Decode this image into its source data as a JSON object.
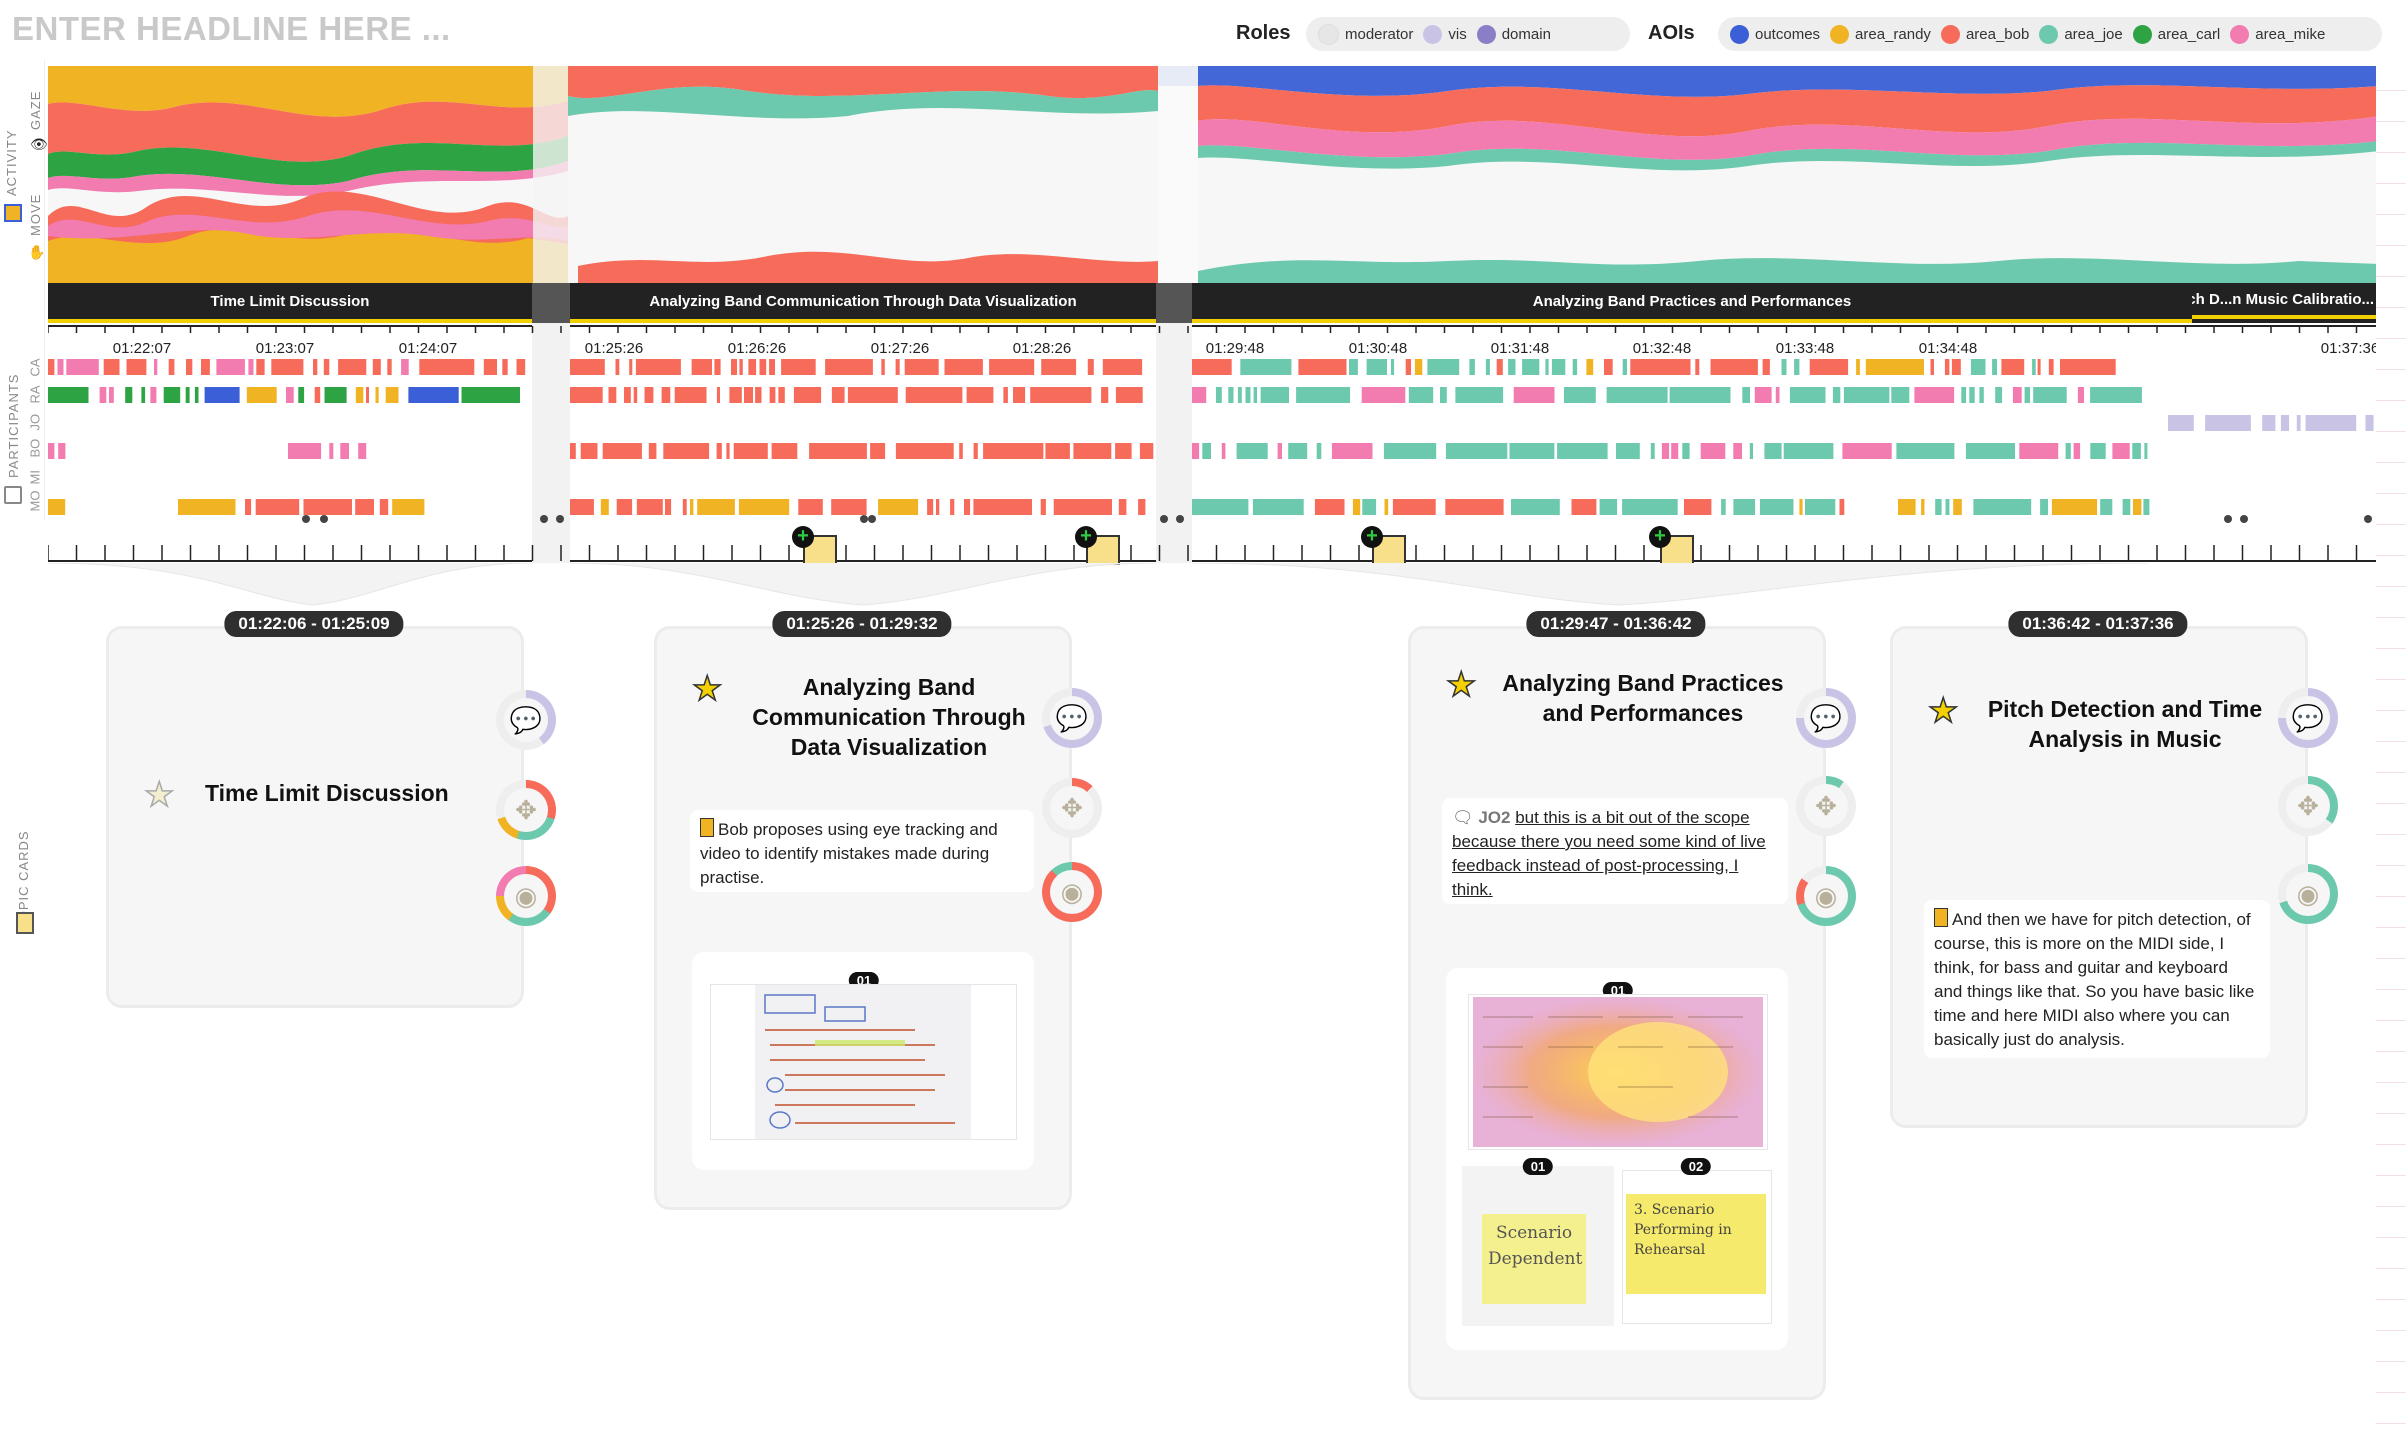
{
  "header": {
    "headline_placeholder": "ENTER HEADLINE HERE ...",
    "roles_label": "Roles",
    "roles": [
      {
        "name": "moderator",
        "color": "#eeeeee"
      },
      {
        "name": "vis",
        "color": "#c9c4e6"
      },
      {
        "name": "domain",
        "color": "#8a7fc6"
      }
    ],
    "aois_label": "AOIs",
    "aois": [
      {
        "name": "outcomes",
        "color": "#3a5fd6"
      },
      {
        "name": "area_randy",
        "color": "#f0b323"
      },
      {
        "name": "area_bob",
        "color": "#f76b5b"
      },
      {
        "name": "area_joe",
        "color": "#6cc9ad"
      },
      {
        "name": "area_carl",
        "color": "#2da344"
      },
      {
        "name": "area_mike",
        "color": "#f27bb0"
      }
    ]
  },
  "side_labels": {
    "activity": "ACTIVITY",
    "gaze": "GAZE",
    "move": "MOVE",
    "participants": "PARTICIPANTS",
    "participant_codes": [
      "CA",
      "RA",
      "JO",
      "BO",
      "MI",
      "MO"
    ],
    "topic_cards": "TOPIC CARDS"
  },
  "topics": [
    {
      "label": "Time Limit Discussion"
    },
    {
      "label": "Analyzing Band Communication Through Data Visualization"
    },
    {
      "label": "Analyzing Band Practices and Performances"
    },
    {
      "label": "Pitch D...n Music Calibratio..."
    }
  ],
  "ticks": [
    "01:22:07",
    "01:23:07",
    "01:24:07",
    "01:25:26",
    "01:26:26",
    "01:27:26",
    "01:28:26",
    "01:29:48",
    "01:30:48",
    "01:31:48",
    "01:32:48",
    "01:33:48",
    "01:34:48",
    "01:37:36"
  ],
  "cards": [
    {
      "time": "01:22:06 - 01:25:09",
      "title": "Time Limit Discussion",
      "starred": false,
      "quote": ""
    },
    {
      "time": "01:25:26 - 01:29:32",
      "title": "Analyzing Band Communication Through Data Visualization",
      "starred": true,
      "quote": "Bob proposes using eye tracking and video to identify mistakes made during practise.",
      "image_badges": [
        "01"
      ]
    },
    {
      "time": "01:29:47 - 01:36:42",
      "title": "Analyzing Band Practices and Performances",
      "starred": true,
      "quote_speaker": "JO2",
      "quote": "but this is a bit out of the scope because there you need some kind of live feedback instead of post-processing, I think.",
      "image_badges": [
        "01",
        "01",
        "02"
      ],
      "sticky_texts": [
        "Scenario Dependent",
        "3. Scenario Performing in Rehearsal"
      ]
    },
    {
      "time": "01:36:42 - 01:37:36",
      "title": "Pitch Detection and Time Analysis in Music",
      "starred": true,
      "quote": "And then we have for pitch detection, of course, this is more on the MIDI side, I think, for bass and guitar and keyboard and things like that. So you have basic like time and here MIDI also where you can basically just do analysis."
    }
  ]
}
